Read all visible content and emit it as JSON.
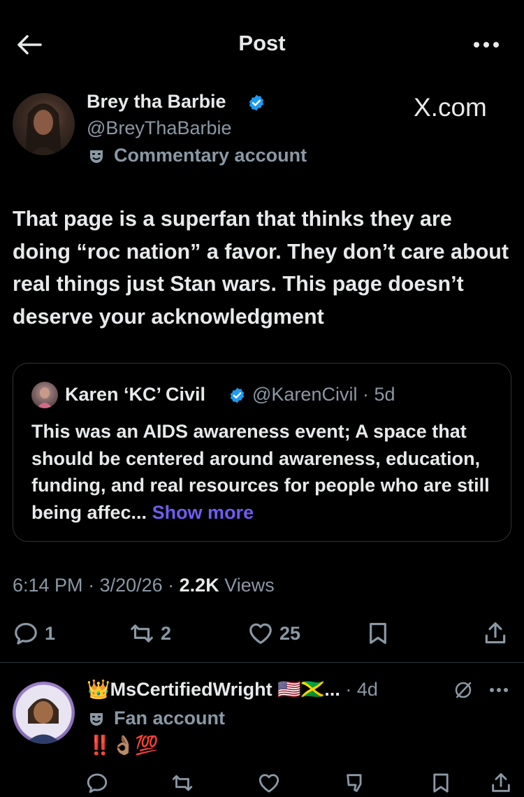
{
  "header": {
    "title": "Post"
  },
  "author": {
    "display_name": "Brey tha Barbie",
    "handle": "@BreyThaBarbie",
    "label": "Commentary account"
  },
  "brand": "X.com",
  "post": {
    "text": "That page is a superfan that thinks they are doing “roc nation” a favor. They don’t care about real things just Stan wars. This page doesn’t deserve your acknowledgment"
  },
  "quote": {
    "display_name": "Karen ‘KC’ Civil",
    "handle": "@KarenCivil",
    "time": "· 5d",
    "text": "This was an AIDS awareness event; A space that should be centered around awareness, education, funding, and real resources for people who are still being affec...",
    "show_more": "Show more"
  },
  "meta": {
    "time": "6:14 PM",
    "date": "3/20/26",
    "views_count": "2.2K",
    "views_label": "Views",
    "sep": " · "
  },
  "actions": {
    "replies": "1",
    "reposts": "2",
    "likes": "25"
  },
  "reply": {
    "display_name": "👑MsCertifiedWright 🇺🇸🇯🇲...",
    "time": "· 4d",
    "label": "Fan account",
    "text": "‼️👌🏽💯"
  },
  "colors": {
    "background": "#000000",
    "text_primary": "#e7e9ea",
    "text_secondary": "#8b98a5",
    "verified": "#1d9bf0",
    "link": "#6e5cf0",
    "border": "#2f3336"
  }
}
